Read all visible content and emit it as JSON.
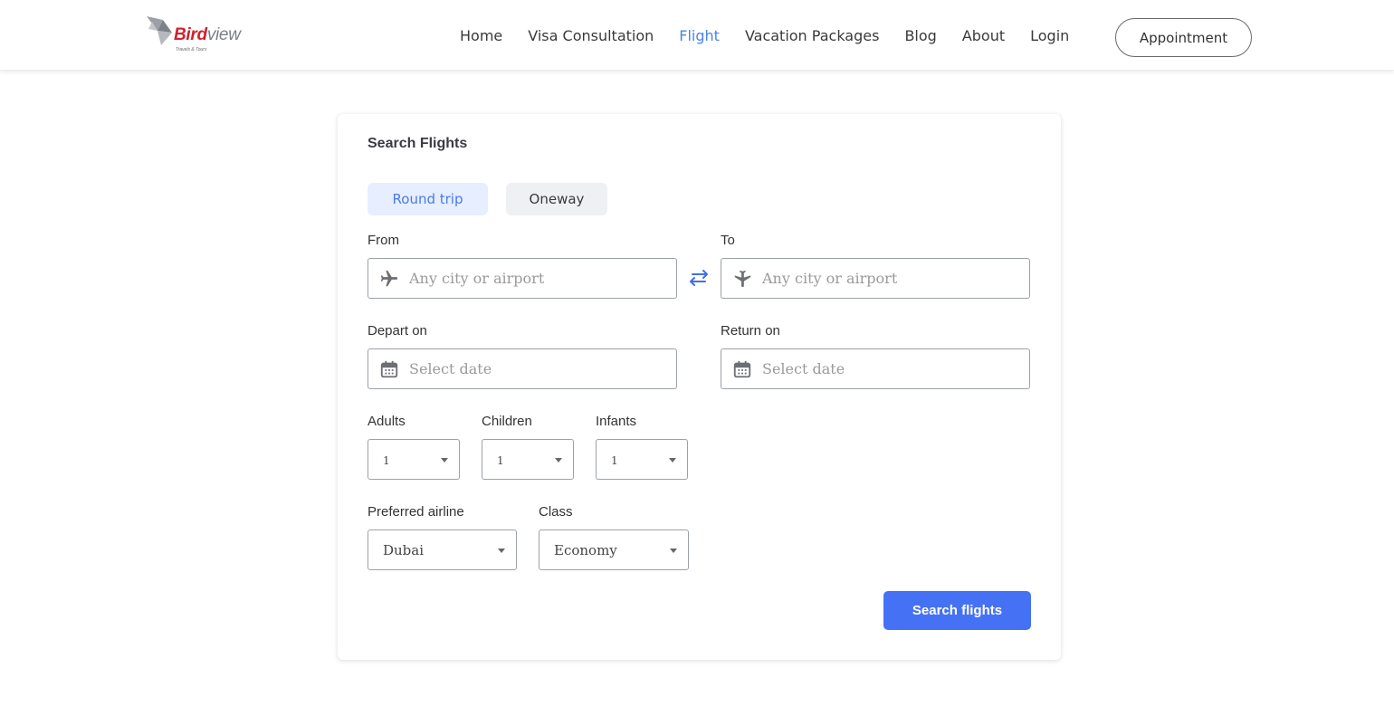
{
  "brand": {
    "name_part1": "Bird",
    "name_part2": "view",
    "tagline": "Travels & Tours",
    "accent": "#d0202e"
  },
  "nav": {
    "items": [
      {
        "label": "Home"
      },
      {
        "label": "Visa Consultation"
      },
      {
        "label": "Flight",
        "active": true
      },
      {
        "label": "Vacation Packages"
      },
      {
        "label": "Blog"
      },
      {
        "label": "About"
      },
      {
        "label": "Login"
      }
    ],
    "appointment_label": "Appointment"
  },
  "search": {
    "title": "Search Flights",
    "trip_types": {
      "round_trip": "Round trip",
      "oneway": "Oneway",
      "selected": "Round trip"
    },
    "from": {
      "label": "From",
      "placeholder": "Any city or airport",
      "icon": "plane-takeoff-icon"
    },
    "to": {
      "label": "To",
      "placeholder": "Any city or airport",
      "icon": "plane-landing-icon"
    },
    "depart": {
      "label": "Depart on",
      "placeholder": "Select date",
      "icon": "calendar-icon"
    },
    "return": {
      "label": "Return on",
      "placeholder": "Select date",
      "icon": "calendar-icon"
    },
    "adults": {
      "label": "Adults",
      "value": "1"
    },
    "children": {
      "label": "Children",
      "value": "1"
    },
    "infants": {
      "label": "Infants",
      "value": "1"
    },
    "airline": {
      "label": "Preferred airline",
      "value": "Dubai"
    },
    "class": {
      "label": "Class",
      "value": "Economy"
    },
    "submit_label": "Search flights"
  },
  "colors": {
    "primary": "#4572f5",
    "active_nav": "#4a83f0",
    "round_trip_bg": "#e6eeff"
  }
}
